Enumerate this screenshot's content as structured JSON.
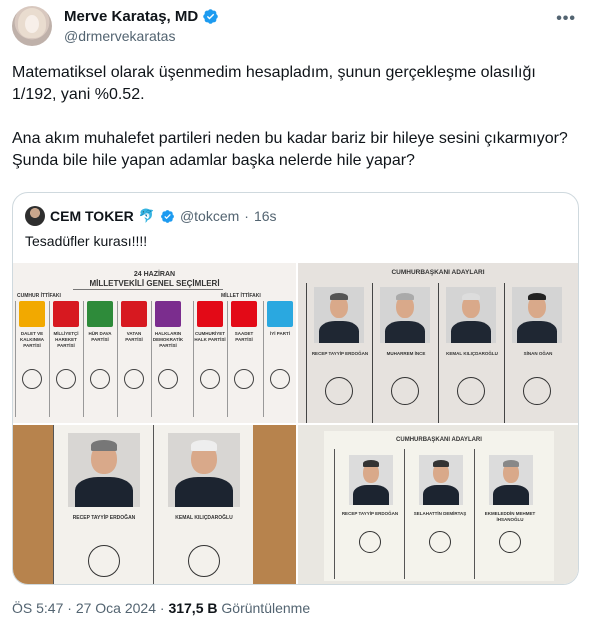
{
  "header": {
    "display_name": "Merve Karataş, MD",
    "handle": "@drmervekaratas",
    "more_label": "•••",
    "verified_color": "#1d9bf0"
  },
  "tweet": {
    "paragraphs": [
      "Matematiksel olarak üşenmedim hesapladım, şunun gerçekleşme olasılığı 1/192, yani %0.52.",
      "Ana akım muhalefet partileri neden bu kadar bariz bir hileye sesini çıkarmıyor? Şunda bile hile yapan adamlar başka nelerde hile yapar?"
    ]
  },
  "quote": {
    "name": "CEM TOKER",
    "emoji": "🐬",
    "handle": "@tokcem",
    "separator": "·",
    "time": "16s",
    "text": "Tesadüfler kurası!!!!",
    "images": {
      "ballot1": {
        "title_line1": "24 HAZİRAN",
        "title_line2": "MİLLETVEKİLİ GENEL SEÇİMLERİ",
        "alliance_left": "CUMHUR İTTİFAKI",
        "alliance_right": "MİLLET İTTİFAKI",
        "parties": [
          {
            "name": "DALET VE KALKINMA PARTİSİ",
            "color": "#f2a900"
          },
          {
            "name": "MİLLİYETÇİ HAREKET PARTİSİ",
            "color": "#d71920"
          },
          {
            "name": "HÜR DAVA PARTİSİ",
            "color": "#2e8b3a"
          },
          {
            "name": "VATAN PARTİSİ",
            "color": "#d71920"
          },
          {
            "name": "HALKLARIN DEMOKRATİK PARTİSİ",
            "color": "#7b2d8e"
          },
          {
            "name": "CUMHURİYET HALK PARTİSİ",
            "color": "#e30a17"
          },
          {
            "name": "SAADET PARTİSİ",
            "color": "#e30a17"
          },
          {
            "name": "İYİ PARTİ",
            "color": "#2aa8e0"
          }
        ]
      },
      "ballot2": {
        "title": "CUMHURBAŞKANI ADAYLARI",
        "candidates": [
          "RECEP TAYYİP ERDOĞAN",
          "MUHARREM İNCE",
          "KEMAL KILIÇDAROĞLU",
          "SİNAN OĞAN"
        ]
      },
      "ballot3": {
        "candidates": [
          "RECEP TAYYİP ERDOĞAN",
          "KEMAL KILIÇDAROĞLU"
        ]
      },
      "ballot4": {
        "title": "CUMHURBAŞKANI ADAYLARI",
        "candidates": [
          "RECEP TAYYİP ERDOĞAN",
          "SELAHATTİN DEMİRTAŞ",
          "EKMELEDDİN MEHMET İHSANOĞLU"
        ]
      }
    }
  },
  "meta": {
    "time": "ÖS 5:47",
    "separator": "·",
    "date": "27 Oca 2024",
    "views_count": "317,5 B",
    "views_label": "Görüntülenme"
  }
}
